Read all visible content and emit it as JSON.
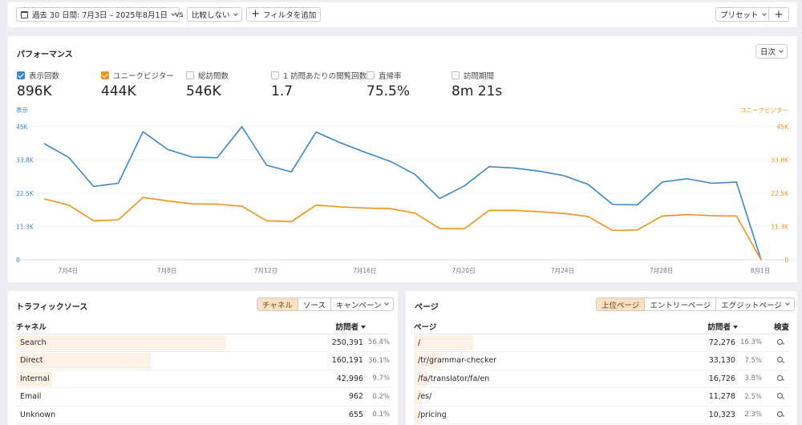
{
  "toolbar": {
    "date_range": "過去 30 日間: 7月3日 – 2025年8月1日",
    "vs": "vs",
    "compare": "比較しない",
    "add_filter": "フィルタを追加",
    "preset": "プリセット",
    "add": "+"
  },
  "performance": {
    "title": "パフォーマンス",
    "interval": "日次",
    "metrics": [
      {
        "label": "表示回数",
        "value": "896K",
        "checked": true,
        "color": "#3a87c8"
      },
      {
        "label": "ユニークビジター",
        "value": "444K",
        "checked": true,
        "color": "#f0921e"
      },
      {
        "label": "総訪問数",
        "value": "546K",
        "checked": false,
        "color": ""
      },
      {
        "label": "1 訪問あたりの閲覧回数",
        "value": "1.7",
        "checked": false,
        "color": ""
      },
      {
        "label": "直帰率",
        "value": "75.5%",
        "checked": false,
        "color": ""
      },
      {
        "label": "訪問期間",
        "value": "8m 21s",
        "checked": false,
        "color": ""
      }
    ]
  },
  "chart_data": {
    "type": "line",
    "left_axis_label": "表示",
    "right_axis_label": "ユニークビジター",
    "y_ticks": [
      "0",
      "11.3K",
      "22.5K",
      "33.8K",
      "45K"
    ],
    "y_max": 45000,
    "x_ticks": [
      {
        "index": 1,
        "label": "7月4日"
      },
      {
        "index": 5,
        "label": "7月8日"
      },
      {
        "index": 9,
        "label": "7月12日"
      },
      {
        "index": 13,
        "label": "7月16日"
      },
      {
        "index": 17,
        "label": "7月20日"
      },
      {
        "index": 21,
        "label": "7月24日"
      },
      {
        "index": 25,
        "label": "7月28日"
      },
      {
        "index": 29,
        "label": "8月1日"
      }
    ],
    "x_count": 30,
    "series": [
      {
        "name": "表示回数",
        "color": "#3a87c8",
        "values": [
          39300,
          34600,
          24800,
          25900,
          43300,
          37300,
          34700,
          34500,
          45000,
          32000,
          29700,
          43200,
          39500,
          36300,
          33300,
          28900,
          20700,
          25000,
          31500,
          31000,
          30000,
          28500,
          25500,
          18700,
          18600,
          26300,
          27400,
          25900,
          26300,
          0
        ]
      },
      {
        "name": "ユニークビジター",
        "color": "#f0921e",
        "values": [
          20600,
          18500,
          13200,
          13500,
          21100,
          19900,
          18900,
          18800,
          18100,
          13200,
          12900,
          18500,
          17900,
          17500,
          17300,
          15800,
          10600,
          10500,
          16700,
          16700,
          16300,
          15700,
          14600,
          9900,
          10100,
          14800,
          15300,
          14900,
          14800,
          0
        ]
      }
    ]
  },
  "traffic": {
    "title": "トラフィックソース",
    "tabs": [
      "チャネル",
      "ソース",
      "キャンペーン"
    ],
    "col_channel": "チャネル",
    "col_visitors": "訪問者",
    "rows": [
      {
        "name": "Search",
        "value": "250,391",
        "pct": "56.4%",
        "share": 0.564
      },
      {
        "name": "Direct",
        "value": "160,191",
        "pct": "36.1%",
        "share": 0.361
      },
      {
        "name": "Internal",
        "value": "42,996",
        "pct": "9.7%",
        "share": 0.097
      },
      {
        "name": "Email",
        "value": "962",
        "pct": "0.2%",
        "share": 0.002
      },
      {
        "name": "Unknown",
        "value": "655",
        "pct": "0.1%",
        "share": 0.001
      }
    ]
  },
  "pages": {
    "title": "ページ",
    "tabs": [
      "上位ページ",
      "エントリーページ",
      "エグジットページ"
    ],
    "col_page": "ページ",
    "col_visitors": "訪問者",
    "col_inspect": "検査",
    "rows": [
      {
        "name": "/",
        "value": "72,276",
        "pct": "16.3%",
        "share": 0.163
      },
      {
        "name": "/tr/grammar-checker",
        "value": "33,130",
        "pct": "7.5%",
        "share": 0.075
      },
      {
        "name": "/fa/translator/fa/en",
        "value": "16,726",
        "pct": "3.8%",
        "share": 0.038
      },
      {
        "name": "/es/",
        "value": "11,278",
        "pct": "2.5%",
        "share": 0.025
      },
      {
        "name": "/pricing",
        "value": "10,323",
        "pct": "2.3%",
        "share": 0.023
      }
    ]
  }
}
